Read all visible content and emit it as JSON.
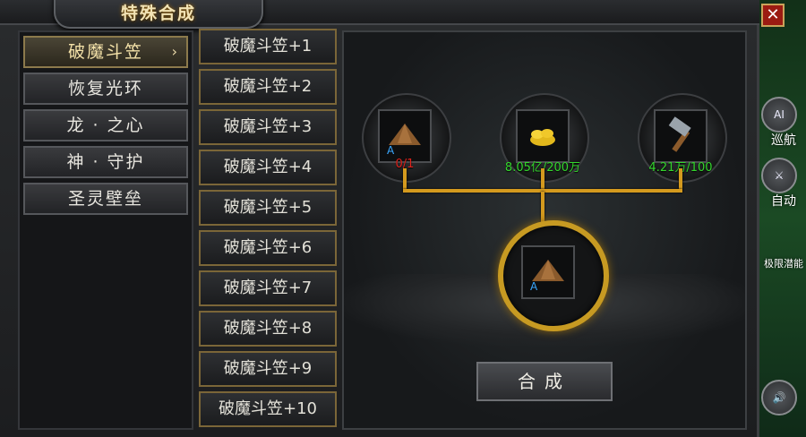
{
  "window": {
    "title": "特殊合成",
    "close_label": "✕"
  },
  "categories": [
    "破魔斗笠",
    "恢复光环",
    "龙 · 之心",
    "神 · 守护",
    "圣灵壁垒"
  ],
  "selected_arrow": "›",
  "items": [
    "破魔斗笠+1",
    "破魔斗笠+2",
    "破魔斗笠+3",
    "破魔斗笠+4",
    "破魔斗笠+5",
    "破魔斗笠+6",
    "破魔斗笠+7",
    "破魔斗笠+8",
    "破魔斗笠+9",
    "破魔斗笠+10"
  ],
  "materials": [
    {
      "icon": "straw-hat-icon",
      "requirement": "0/1",
      "color": "#e0231c"
    },
    {
      "icon": "gold-ingots-icon",
      "requirement": "8.05亿/200万",
      "color": "#33d62c"
    },
    {
      "icon": "forge-hammer-icon",
      "requirement": "4.21万/100",
      "color": "#33d62c"
    }
  ],
  "result": {
    "icon": "straw-hat-icon"
  },
  "craft_button": "合成",
  "sidebar": {
    "cruise": "巡航",
    "auto": "自动",
    "ai_badge": "AI",
    "limit": "极限潜能"
  },
  "colors": {
    "accent_gold": "#d49a1e",
    "fail_red": "#e0231c",
    "ok_green": "#33d62c"
  }
}
